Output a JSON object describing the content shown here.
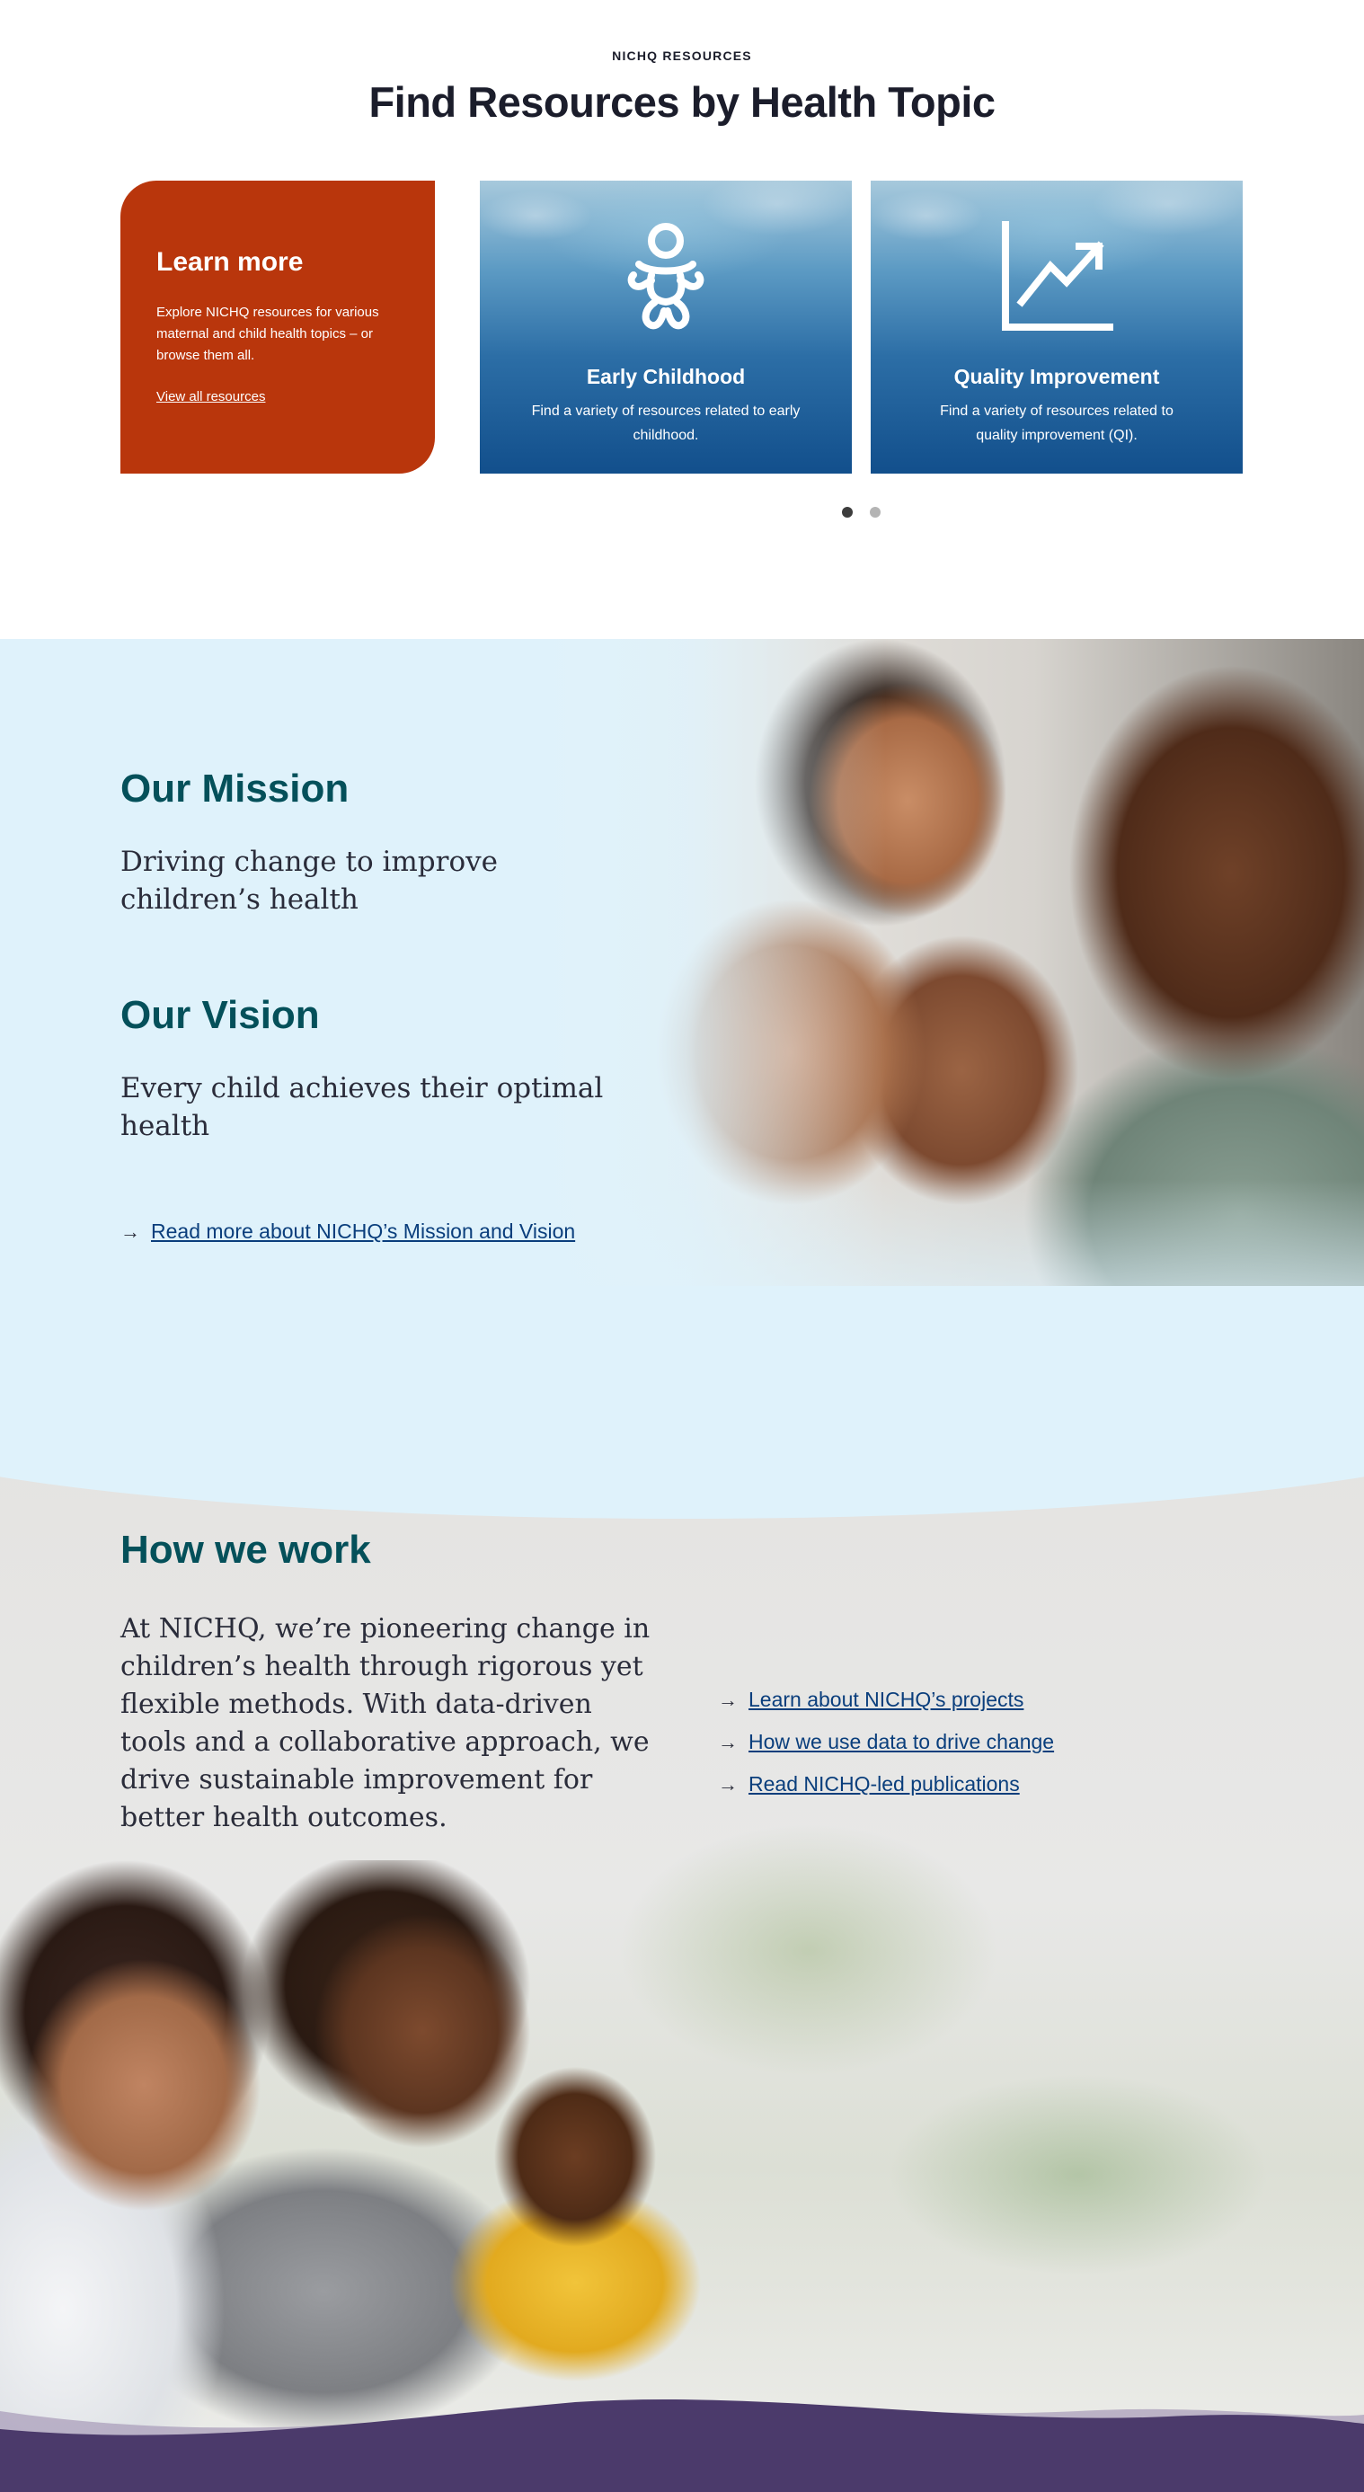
{
  "resources": {
    "eyebrow": "NICHQ RESOURCES",
    "title": "Find Resources by Health Topic",
    "learn_card": {
      "title": "Learn more",
      "text": "Explore NICHQ resources for various maternal and child health topics – or browse them all.",
      "link": "View all resources",
      "color": "#b9360c"
    },
    "topics": [
      {
        "title": "Early Childhood",
        "text": "Find a variety of resources related to early childhood.",
        "icon": "baby-icon"
      },
      {
        "title": "Quality Improvement",
        "text": "Find a variety of resources related to quality improvement (QI).",
        "icon": "trending-chart-icon"
      }
    ],
    "carousel": {
      "pages": 2,
      "active": 1
    }
  },
  "mission": {
    "mission_title": "Our Mission",
    "mission_text": "Driving change to improve children’s health",
    "vision_title": "Our Vision",
    "vision_text": "Every child achieves their optimal health",
    "link": "Read more about NICHQ’s Mission and Vision",
    "heading_color": "#04505a",
    "background": "#dff2fb"
  },
  "how": {
    "title": "How we work",
    "intro": "At NICHQ, we’re pioneering change in children’s health through rigorous yet flexible methods. With data-driven tools and a collaborative approach, we drive sustainable improvement for better health outcomes.",
    "links": [
      "Learn about NICHQ’s projects",
      "How we use data to drive change",
      "Read NICHQ-led publications"
    ],
    "link_color": "#0a3e7c",
    "footer_color": "#4b3a6b"
  }
}
